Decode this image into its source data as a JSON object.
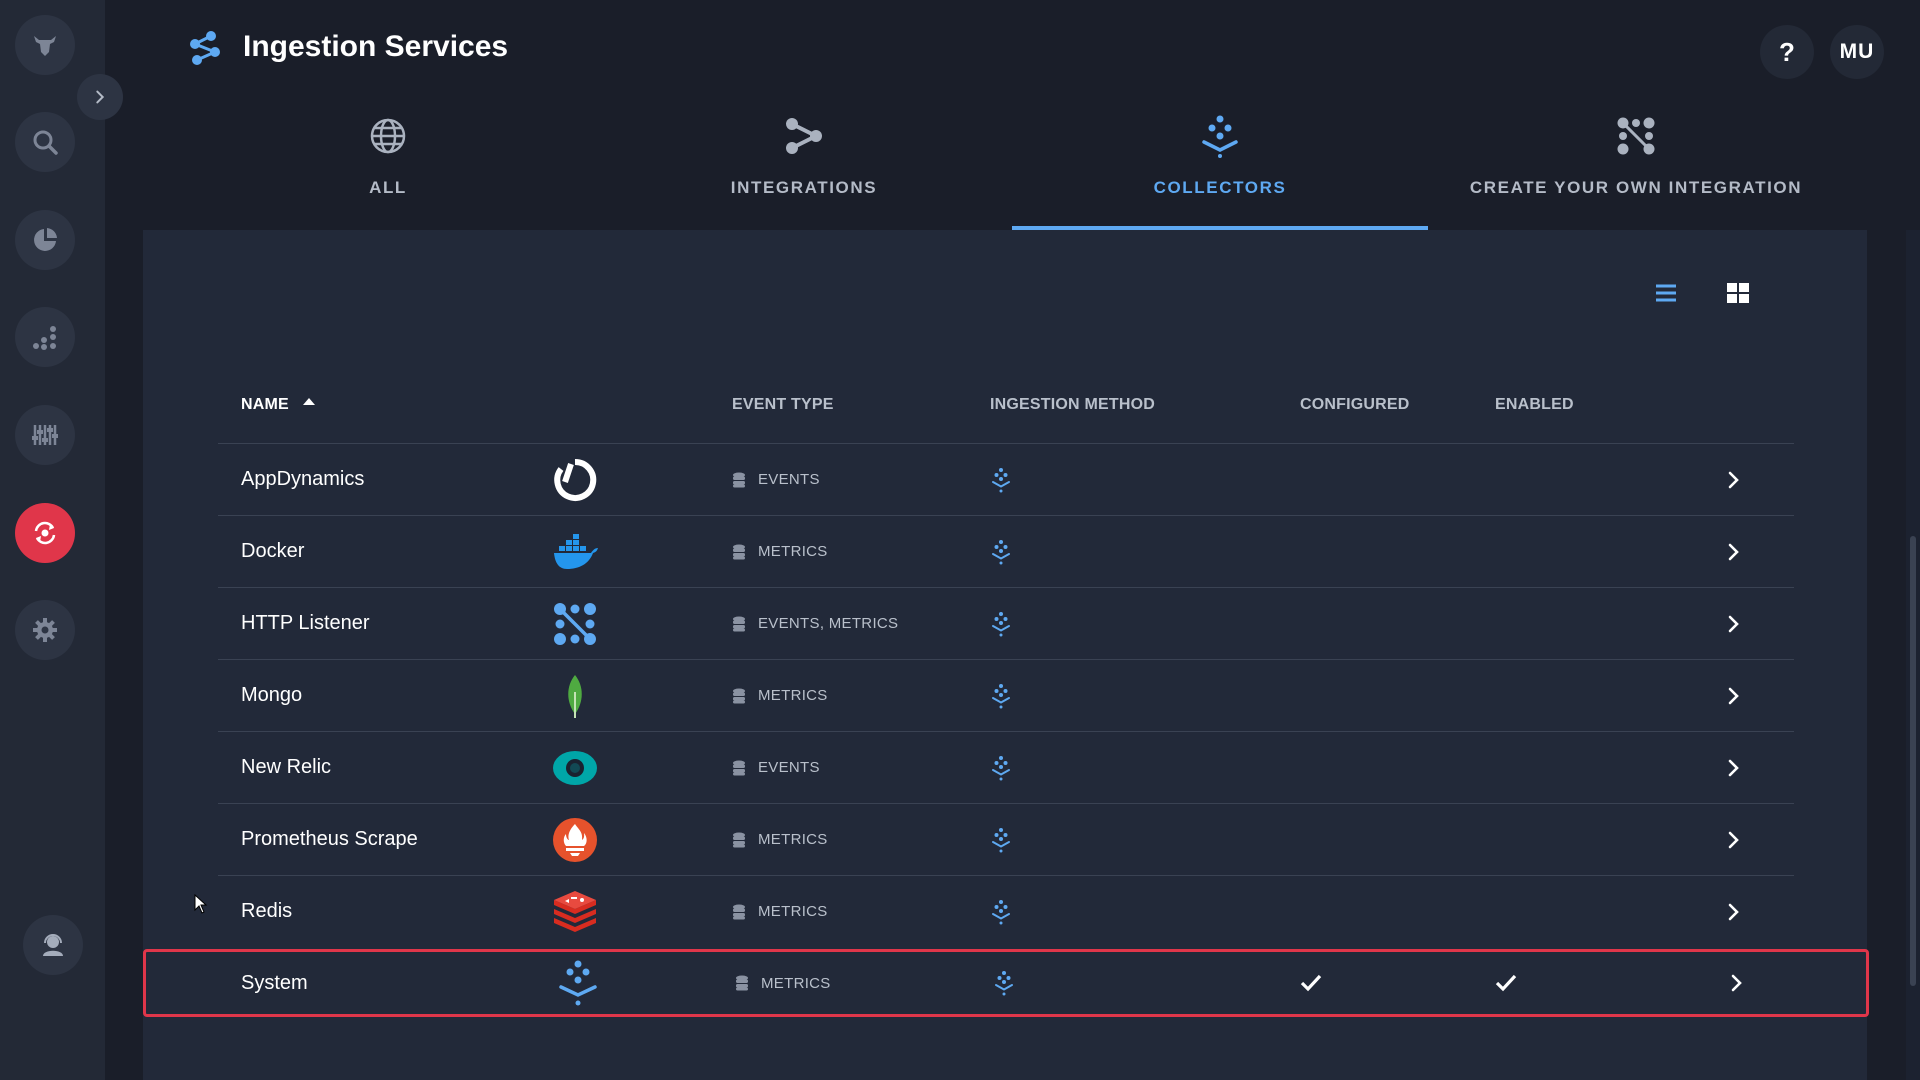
{
  "app": {
    "title": "Ingestion Services"
  },
  "header": {
    "help_label": "?",
    "user_initials": "MU"
  },
  "sidebar": {
    "items": [
      {
        "icon": "bull-logo-icon"
      },
      {
        "icon": "search-icon"
      },
      {
        "icon": "pie-chart-icon"
      },
      {
        "icon": "scatter-chart-icon"
      },
      {
        "icon": "sliders-icon"
      },
      {
        "icon": "sync-icon",
        "active": true
      },
      {
        "icon": "gear-icon"
      },
      {
        "icon": "support-agent-icon"
      }
    ]
  },
  "tabs": [
    {
      "label": "ALL",
      "icon": "globe-icon"
    },
    {
      "label": "INTEGRATIONS",
      "icon": "integrations-icon"
    },
    {
      "label": "COLLECTORS",
      "icon": "collector-icon",
      "active": true
    },
    {
      "label": "CREATE YOUR OWN INTEGRATION",
      "icon": "custom-integration-icon"
    }
  ],
  "table": {
    "headers": {
      "name": "NAME",
      "event_type": "EVENT TYPE",
      "ingestion_method": "INGESTION METHOD",
      "configured": "CONFIGURED",
      "enabled": "ENABLED"
    },
    "sort": {
      "column": "name",
      "direction": "ascending"
    },
    "rows": [
      {
        "name": "AppDynamics",
        "logo": "appdynamics-logo",
        "event_type": "EVENTS",
        "configured": false,
        "enabled": false
      },
      {
        "name": "Docker",
        "logo": "docker-logo",
        "event_type": "METRICS",
        "configured": false,
        "enabled": false
      },
      {
        "name": "HTTP Listener",
        "logo": "http-listener-logo",
        "event_type": "EVENTS, METRICS",
        "configured": false,
        "enabled": false
      },
      {
        "name": "Mongo",
        "logo": "mongo-logo",
        "event_type": "METRICS",
        "configured": false,
        "enabled": false
      },
      {
        "name": "New Relic",
        "logo": "new-relic-logo",
        "event_type": "EVENTS",
        "configured": false,
        "enabled": false
      },
      {
        "name": "Prometheus Scrape",
        "logo": "prometheus-logo",
        "event_type": "METRICS",
        "configured": false,
        "enabled": false
      },
      {
        "name": "Redis",
        "logo": "redis-logo",
        "event_type": "METRICS",
        "configured": false,
        "enabled": false
      },
      {
        "name": "System",
        "logo": "system-collector-logo",
        "event_type": "METRICS",
        "configured": true,
        "enabled": true,
        "selected": true
      }
    ]
  },
  "colors": {
    "accent": "#5ea9f2",
    "danger": "#e0364a",
    "background": "#1a1e29",
    "panel": "#222939"
  }
}
